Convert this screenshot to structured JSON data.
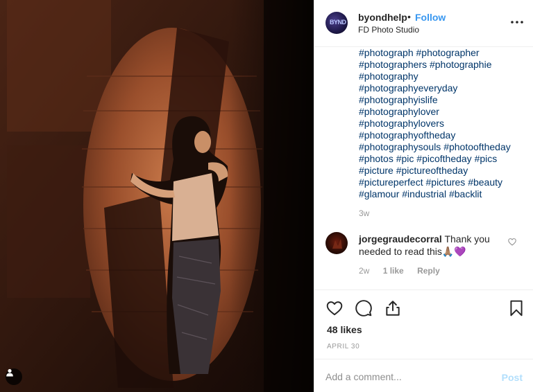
{
  "post": {
    "username": "byondhelp",
    "separator": "•",
    "follow_label": "Follow",
    "location": "FD Photo Studio",
    "avatar_text": "BYND",
    "more_icon": "more-options-icon"
  },
  "caption": {
    "hashtag_lines": [
      "#photograph #photographer",
      "#photographers #photographie",
      "#photography",
      "#photographyeveryday",
      "#photographyislife",
      "#photographylover",
      "#photographylovers",
      "#photographyoftheday",
      "#photographysouls #photooftheday",
      "#photos #pic #picoftheday #pics",
      "#picture #pictureoftheday",
      "#pictureperfect #pictures #beauty",
      "#glamour #industrial #backlit"
    ],
    "time": "3w"
  },
  "comment": {
    "username": "jorgegraudecorral",
    "text": " Thank you needed to read this🙏🏽💜",
    "time": "2w",
    "likes": "1 like",
    "reply_label": "Reply"
  },
  "actions": {
    "icons": [
      "heart-icon",
      "comment-icon",
      "share-icon",
      "bookmark-icon"
    ]
  },
  "stats": {
    "likes": "48 likes",
    "date": "APRIL 30"
  },
  "add_comment": {
    "placeholder": "Add a comment...",
    "post_label": "Post"
  },
  "colors": {
    "link": "#003569",
    "follow": "#3897f0",
    "muted": "#999999",
    "post_disabled": "#b2dffc"
  }
}
